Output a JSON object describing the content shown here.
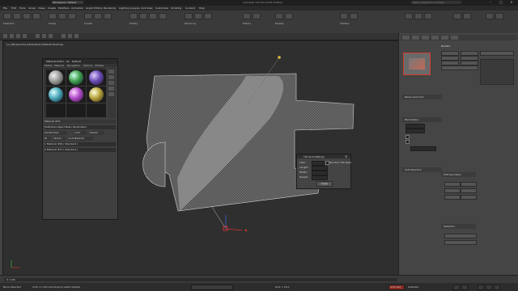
{
  "title_bar": {
    "workspace": "Workspace: Default",
    "title": "Autodesk 3ds Max 2018   Untitled",
    "search_placeholder": "Type a keyword or phrase",
    "win_min": "–",
    "win_max": "□",
    "win_close": "✕"
  },
  "menu": [
    "File",
    "Edit",
    "Tools",
    "Group",
    "Views",
    "Create",
    "Modifiers",
    "Animation",
    "Graph Editors",
    "Rendering",
    "Lighting Analysis",
    "Civil View",
    "Customize",
    "Scripting",
    "Content",
    "Help"
  ],
  "ribbon": {
    "labels": [
      "Selection",
      "Snaps",
      "Create",
      "Modify",
      "Hierarchy",
      "Motion",
      "Display",
      "Utilities"
    ]
  },
  "viewport": {
    "label": "[+] [Perspective] [Standard] [Default Shading]"
  },
  "material_editor": {
    "title": "Material Editor - 01 - Default",
    "menu": [
      "Modes",
      "Material",
      "Navigation",
      "Options",
      "Utilities"
    ],
    "material_name": "Material #25",
    "params": [
      "Multi/Sub-Object Basic Parameters",
      "Set Number",
      "Add",
      "Delete",
      "ID",
      "Name",
      "Sub-Material"
    ],
    "rows": [
      "1    Material #26 ( Standard )",
      "2    Material #27 ( Standard )"
    ],
    "sphere_colors": [
      "#9a9a9a",
      "#3f9e4c",
      "#6a4bb5",
      "#4aa7b8",
      "#b04ac8",
      "#b4a23c"
    ]
  },
  "command_panel": {
    "object_name": "Box001",
    "rollouts": [
      "Name and Color",
      "Parameters",
      "Soft Selection",
      "Edit Geometry",
      "Selection"
    ],
    "accent": "#d13b2d"
  },
  "dialog": {
    "title": "Tile Grid Settings",
    "rows": [
      "Tiles: ",
      "Random Tile Seed",
      "Length: ",
      "Width: ",
      "Height: "
    ],
    "ok": "Apply"
  },
  "timeline": {
    "frame": "0 / 100"
  },
  "status": {
    "selection": "None Selected",
    "prompt": "Click or click-and-drag to select objects",
    "grid": "Grid = 10.0",
    "mode": "Auto Key",
    "selected": "Selected"
  }
}
